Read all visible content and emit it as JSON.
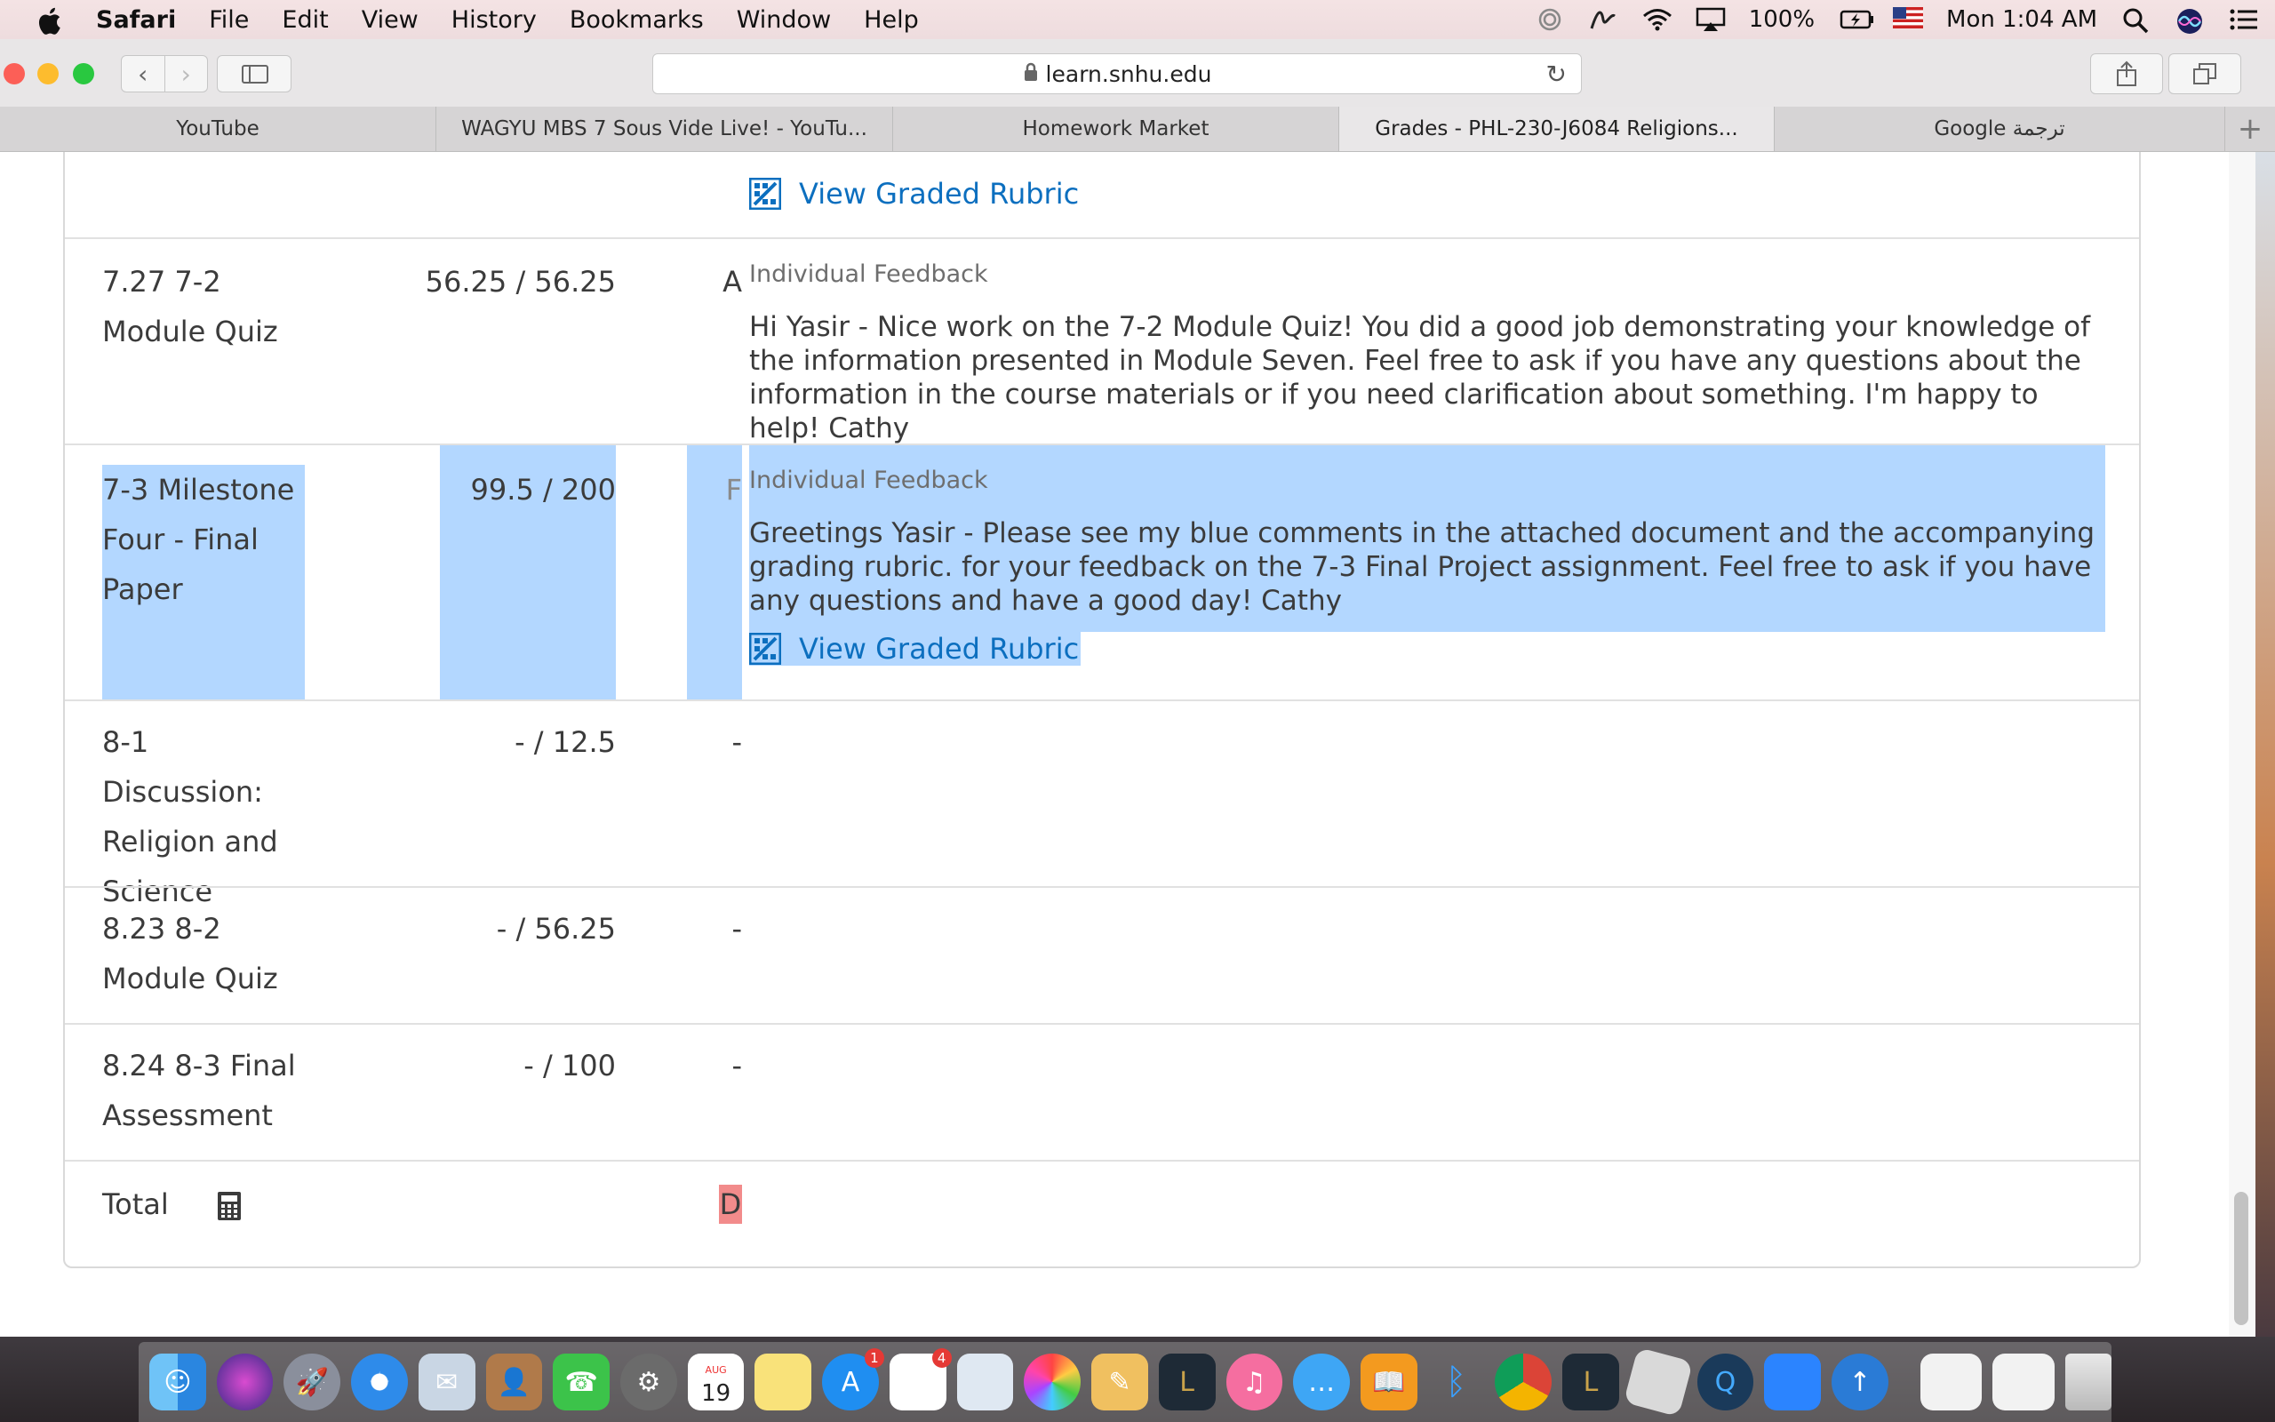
{
  "menubar": {
    "app_name": "Safari",
    "items": [
      "File",
      "Edit",
      "View",
      "History",
      "Bookmarks",
      "Window",
      "Help"
    ],
    "battery": "100%",
    "clock": "Mon 1:04 AM"
  },
  "toolbar": {
    "url": "learn.snhu.edu"
  },
  "tabs": [
    {
      "label": "YouTube"
    },
    {
      "label": "WAGYU MBS 7 Sous Vide Live! - YouTu..."
    },
    {
      "label": "Homework Market"
    },
    {
      "label": "Grades - PHL-230-J6084 Religions..."
    },
    {
      "label": "Google ترجمة"
    }
  ],
  "grades": {
    "top_rubric_link": "View Graded Rubric",
    "rows": [
      {
        "name_line1": "7.27 7-2",
        "name_line2": "Module Quiz",
        "score": "56.25 / 56.25",
        "grade": "A",
        "feedback_label": "Individual Feedback",
        "feedback": "Hi Yasir - Nice work on the 7-2 Module Quiz! You did a good job demonstrating your knowledge of the information presented in Module Seven. Feel free to ask if you have any questions about the information in the course materials or if you need clarification about something. I'm happy to help! Cathy"
      },
      {
        "name_line1": "7-3 Milestone",
        "name_line2": "Four - Final",
        "name_line3": "Paper",
        "score": "99.5 / 200",
        "grade": "F",
        "feedback_label": "Individual Feedback",
        "feedback": "Greetings Yasir - Please see my blue comments in the attached document and the accompanying grading rubric. for your feedback on the 7-3 Final Project assignment. Feel free to ask if you have any questions and have a good day! Cathy",
        "rubric_link": "View Graded Rubric"
      },
      {
        "name_line1": "8-1 Discussion:",
        "name_line2": "Religion and",
        "name_line3": "Science",
        "score": "- / 12.5",
        "grade": "-"
      },
      {
        "name_line1": "8.23 8-2",
        "name_line2": "Module Quiz",
        "score": "- / 56.25",
        "grade": "-"
      },
      {
        "name_line1": "8.24 8-3 Final",
        "name_line2": "Assessment",
        "score": "- / 100",
        "grade": "-"
      }
    ],
    "total": {
      "label": "Total",
      "grade": "D"
    }
  },
  "dock": {
    "calendar_month": "AUG",
    "calendar_day": "19",
    "appstore_badge": "1",
    "reminders_badge": "4"
  },
  "colors": {
    "link": "#0c6fbf",
    "selection": "#b3d7ff",
    "fail_grade": "#f28b8b"
  }
}
